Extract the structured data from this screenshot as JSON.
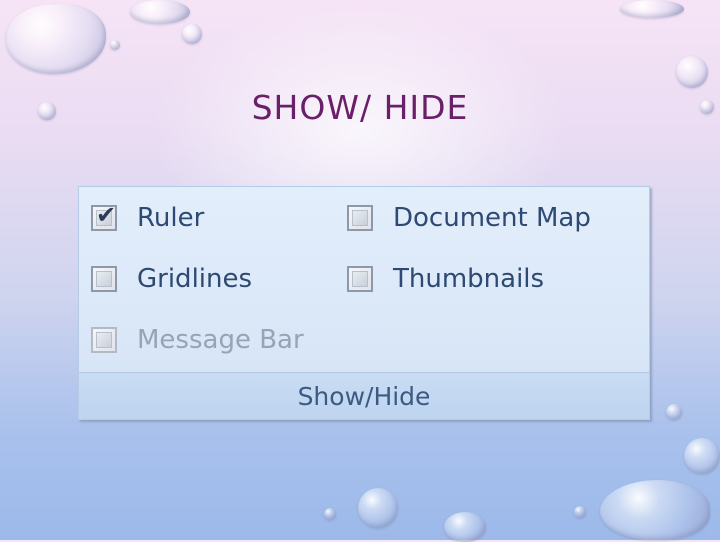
{
  "slide": {
    "title": "SHOW/ HIDE"
  },
  "group": {
    "label": "Show/Hide",
    "items": [
      {
        "label": "Ruler",
        "checked": true,
        "enabled": true
      },
      {
        "label": "Document Map",
        "checked": false,
        "enabled": true
      },
      {
        "label": "Gridlines",
        "checked": false,
        "enabled": true
      },
      {
        "label": "Thumbnails",
        "checked": false,
        "enabled": true
      },
      {
        "label": "Message Bar",
        "checked": false,
        "enabled": false
      }
    ]
  },
  "colors": {
    "title": "#6a1f6a",
    "label": "#2e4a72",
    "label_disabled": "#98a3b3",
    "ribbon_bg": "#dbe8f8",
    "footer_bg": "#c4d8f1"
  },
  "icons": {
    "check": "checkmark-icon"
  }
}
